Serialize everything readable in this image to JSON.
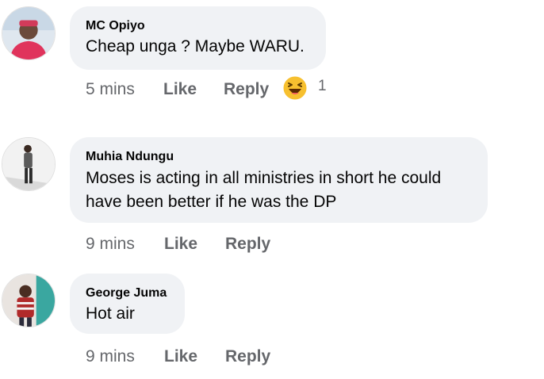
{
  "comments": [
    {
      "author": "MC Opiyo",
      "text": "Cheap unga ? Maybe WARU.",
      "time": "5 mins",
      "like_label": "Like",
      "reply_label": "Reply",
      "reaction": {
        "icon": "laughing-emoji-icon",
        "count": "1"
      }
    },
    {
      "author": "Muhia Ndungu",
      "text_lines": [
        "Moses is acting in all ministries in short he could",
        "have been better if he was the DP"
      ],
      "time": "9 mins",
      "like_label": "Like",
      "reply_label": "Reply"
    },
    {
      "author": "George Juma",
      "text": "Hot air",
      "time": "9 mins",
      "like_label": "Like",
      "reply_label": "Reply"
    }
  ]
}
